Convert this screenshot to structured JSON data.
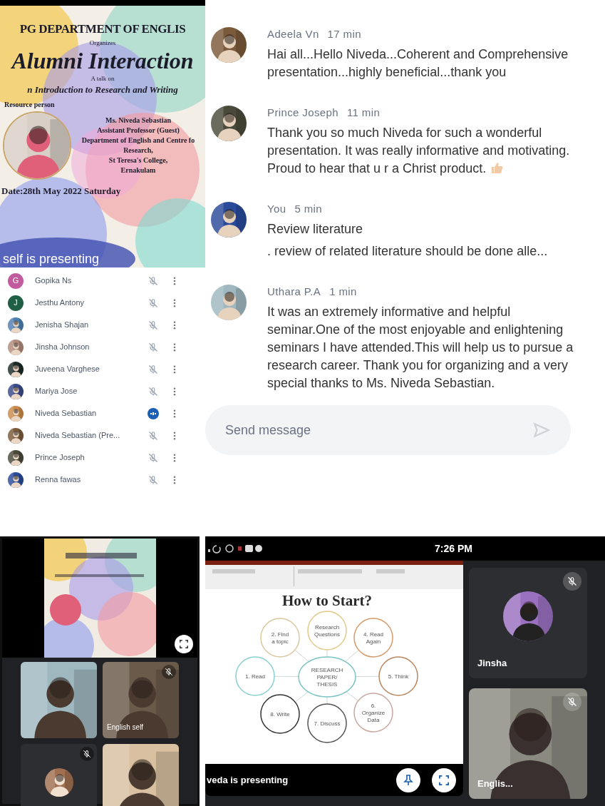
{
  "poster": {
    "lines": [
      {
        "kind": "heading",
        "text": "PG DEPARTMENT OF ENGLIS"
      },
      {
        "kind": "small",
        "text": "Organizes"
      },
      {
        "kind": "title",
        "text": "Alumni Interaction"
      },
      {
        "kind": "small",
        "text": "A talk on"
      },
      {
        "kind": "subtitle",
        "text": "n Introduction to Research and Writing"
      },
      {
        "kind": "label",
        "text": "Resource person"
      }
    ],
    "speaker_lines": [
      "Ms. Niveda Sebastian",
      "Assistant Professor (Guest)",
      "Department of English and Centre fo",
      "Research,",
      "St Teresa's College,",
      "Ernakulam"
    ],
    "date": "Date:28th May 2022 Saturday",
    "overlay": "self is presenting"
  },
  "participants": [
    {
      "name": "Gopika Ns",
      "kind": "letter",
      "initial": "G",
      "color": "#c25a9e",
      "muted": true
    },
    {
      "name": "Jesthu Antony",
      "kind": "letter",
      "initial": "J",
      "color": "#1f5f45",
      "muted": true
    },
    {
      "name": "Jenisha Shajan",
      "muted": true
    },
    {
      "name": "Jinsha Johnson",
      "muted": true
    },
    {
      "name": "Juveena Varghese",
      "muted": true
    },
    {
      "name": "Mariya Jose",
      "muted": true
    },
    {
      "name": "Niveda Sebastian",
      "muted": false
    },
    {
      "name": "Niveda Sebastian (Pre...",
      "muted": true
    },
    {
      "name": "Prince Joseph",
      "muted": true
    },
    {
      "name": "Renna fawas",
      "muted": true
    }
  ],
  "chat": {
    "messages": [
      {
        "sender": "Adeela Vn",
        "time": "17 min",
        "reaction": false,
        "text": "Hai all...Hello Niveda...Coherent and Comprehensive presentation...highly beneficial...thank you"
      },
      {
        "sender": "Prince Joseph",
        "time": "11 min",
        "text": "Thank you so much Niveda for such a wonderful presentation. It was really informative and motivating. Proud to hear that u r a Christ product.",
        "reaction": true
      },
      {
        "sender": "You",
        "time": "5 min",
        "reaction": false,
        "text": "Review literature",
        "preview": ". review of related literature should be done alle..."
      },
      {
        "sender": "Uthara P.A",
        "time": "1 min",
        "reaction": false,
        "text": "It was an extremely informative and helpful seminar.One of the most enjoyable and enlightening seminars I have attended.This will help us to pursue a research career. Thank you for organizing and a very special thanks to Ms. Niveda Sebastian."
      }
    ],
    "input": {
      "placeholder": "Send message"
    }
  },
  "meeting_grid": {
    "tiles": [
      {
        "kind": "video",
        "muted": false
      },
      {
        "kind": "video",
        "name": "English self",
        "muted": true
      },
      {
        "kind": "avatar",
        "muted": true
      },
      {
        "kind": "video",
        "muted": false
      }
    ]
  },
  "presentation": {
    "status_time": "7:26 PM",
    "slide": {
      "title": "How to Start?",
      "center": [
        "RESEARCH",
        "PAPER/",
        "THESIS"
      ],
      "nodes": [
        {
          "lines": [
            "2. Find",
            "a topic"
          ],
          "color": "#d9c9a0"
        },
        {
          "lines": [
            "Research",
            "Questions"
          ],
          "color": "#e3c98a"
        },
        {
          "lines": [
            "4. Read",
            "Again"
          ],
          "color": "#d49a6a"
        },
        {
          "lines": [
            "1. Read"
          ],
          "color": "#8ccfcf"
        },
        {
          "lines": [
            "5. Think"
          ],
          "color": "#b9865e"
        },
        {
          "lines": [
            "8. Write"
          ],
          "color": "#333333"
        },
        {
          "lines": [
            "7. Discuss"
          ],
          "color": "#555555"
        },
        {
          "lines": [
            "6.",
            "Organize",
            "Data"
          ],
          "color": "#c9a8a0"
        }
      ]
    },
    "presenter": "veda is presenting",
    "tiles": [
      {
        "kind": "avatar",
        "name": "Jinsha",
        "muted": true
      },
      {
        "kind": "video",
        "name": "Englis...",
        "muted": true
      }
    ]
  }
}
